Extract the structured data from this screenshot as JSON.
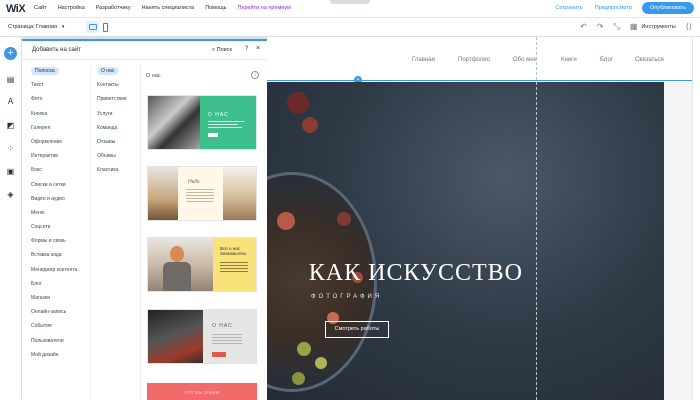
{
  "topbar": {
    "logo": "WiX",
    "menu": [
      "Сайт",
      "Настройка",
      "Разработчику",
      "Нанять специалиста",
      "Помощь"
    ],
    "upgrade": "Перейти на премиум",
    "save": "Сохранить",
    "preview": "Предпросмотр",
    "publish": "Опубликовать"
  },
  "subbar": {
    "page": "Страница: Главная",
    "tools": "Инструменты"
  },
  "panel": {
    "title": "Добавить на сайт",
    "search": "Поиск",
    "help": "?",
    "close": "×",
    "categories": [
      "Полоска",
      "Текст",
      "Фото",
      "Кнопка",
      "Галерея",
      "Оформление",
      "Интерактив",
      "Бокс",
      "Списки и сетки",
      "Видео и аудио",
      "Меню",
      "Соцсети",
      "Формы и связь",
      "Вставка кода",
      "Менеджер контента",
      "Блог",
      "Магазин",
      "Онлайн-запись",
      "События",
      "Пользователи",
      "Мой дизайн"
    ],
    "subcategories": [
      "О нас",
      "Контакты",
      "Приветствие",
      "Услуги",
      "Команда",
      "Отзывы",
      "Объявы",
      "Классика"
    ],
    "section_title": "О нас",
    "info": "i",
    "thumb1_heading": "О НАС",
    "thumb2_heading": "Hello",
    "thumb3_heading": "Всё о нас\nЗнакомьтесь",
    "thumb4_heading": "О НАС",
    "thumb5_label": "ЧТО МЫ ЗНАЕМ"
  },
  "site": {
    "nav": [
      "Главная",
      "Портфолио",
      "Обо мне",
      "Книги",
      "Блог",
      "Связаться"
    ],
    "hero_title": "КАК ИСКУССТВО",
    "hero_subtitle": "ФОТОГРАФИЯ",
    "hero_button": "Смотреть работы"
  }
}
